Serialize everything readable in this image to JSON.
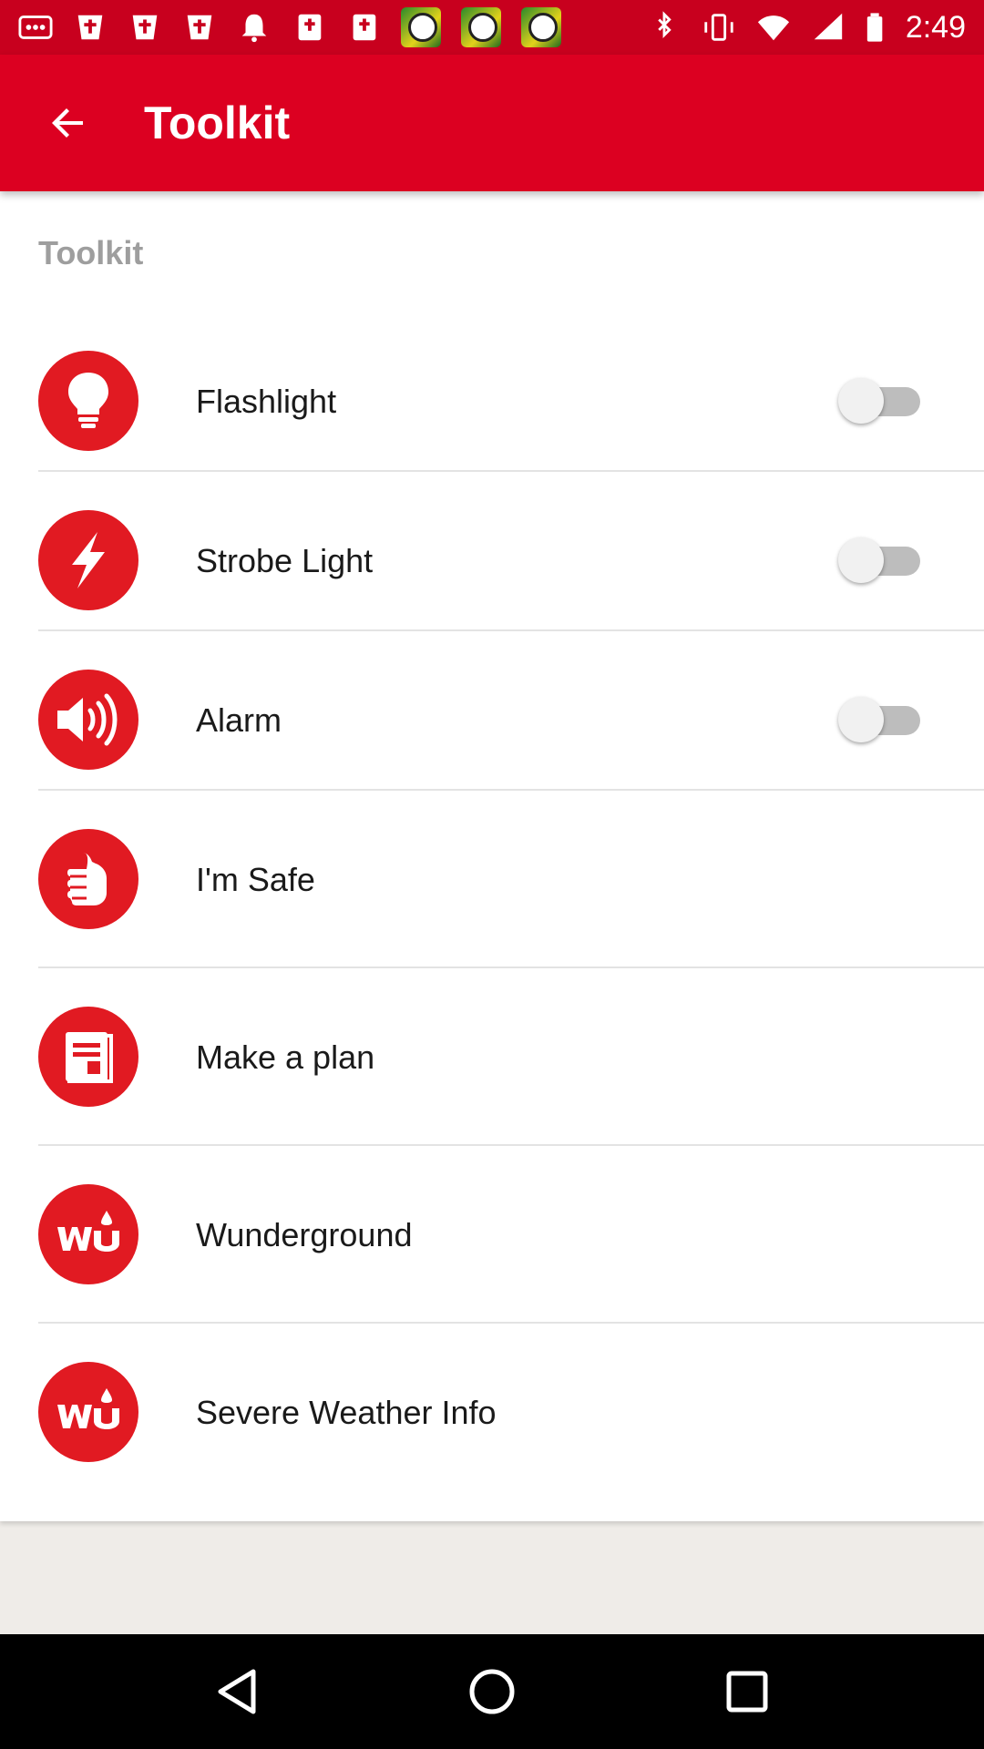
{
  "status_bar": {
    "time": "2:49",
    "left_icons": [
      "more-icon",
      "bible-icon",
      "bible-icon",
      "bible-icon",
      "notification-bell-icon",
      "book-icon",
      "book-icon",
      "soccer-app-icon",
      "soccer-app-icon",
      "soccer-app-icon"
    ],
    "right_icons": [
      "bluetooth-icon",
      "vibrate-icon",
      "wifi-icon",
      "signal-icon",
      "battery-icon"
    ]
  },
  "appbar": {
    "title": "Toolkit",
    "back_icon": "arrow-back-icon"
  },
  "section": {
    "header": "Toolkit"
  },
  "items": [
    {
      "label": "Flashlight",
      "icon": "lightbulb-icon",
      "has_toggle": true,
      "toggle_on": false
    },
    {
      "label": "Strobe Light",
      "icon": "lightning-icon",
      "has_toggle": true,
      "toggle_on": false
    },
    {
      "label": "Alarm",
      "icon": "speaker-icon",
      "has_toggle": true,
      "toggle_on": false
    },
    {
      "label": "I'm Safe",
      "icon": "thumbs-up-icon",
      "has_toggle": false
    },
    {
      "label": "Make a plan",
      "icon": "document-icon",
      "has_toggle": false
    },
    {
      "label": "Wunderground",
      "icon": "wu-logo-icon",
      "has_toggle": false
    },
    {
      "label": "Severe Weather Info",
      "icon": "wu-logo-icon",
      "has_toggle": false
    }
  ],
  "colors": {
    "accent": "#dc0021",
    "icon_bg": "#e11a22",
    "status_bar": "#c8001e"
  },
  "navbar": {
    "buttons": [
      "back-nav-icon",
      "home-nav-icon",
      "recents-nav-icon"
    ]
  }
}
